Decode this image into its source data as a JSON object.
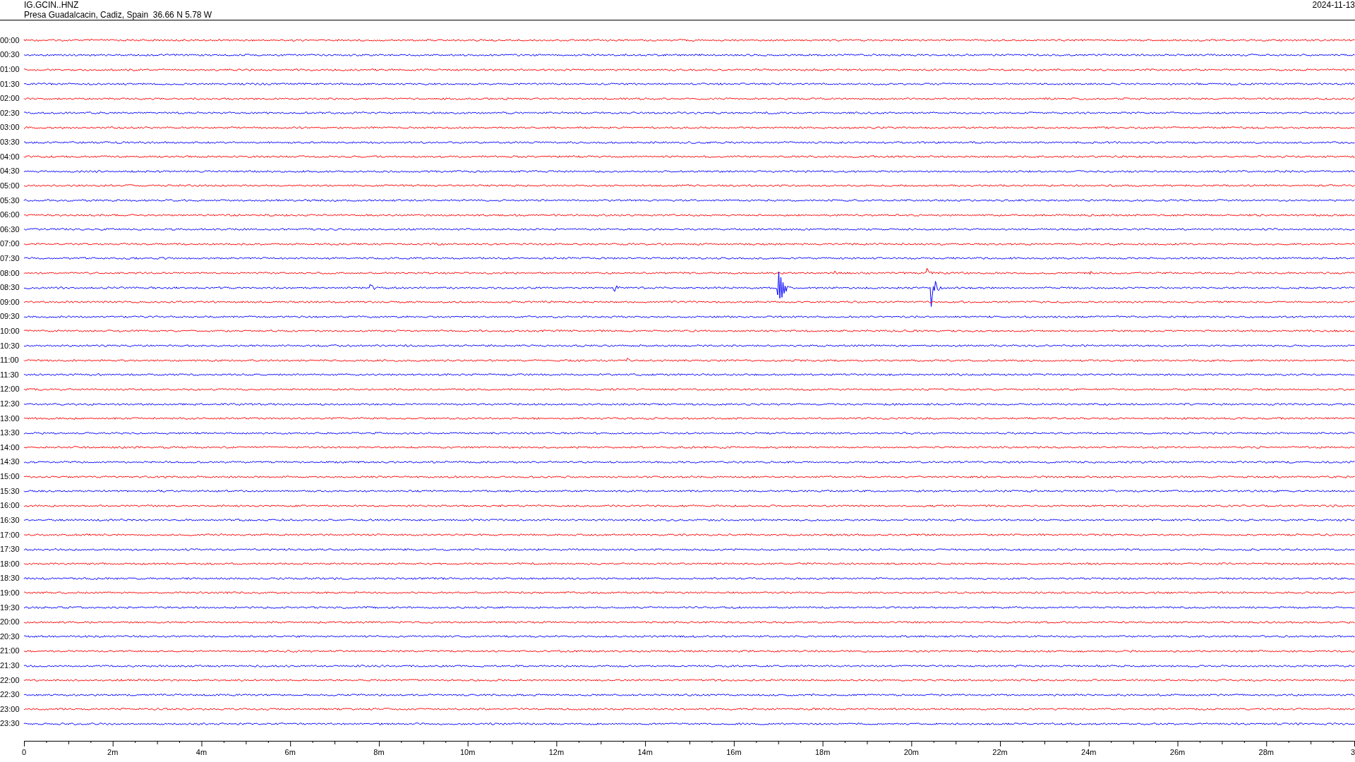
{
  "station": {
    "code": "IG.GCIN..HNZ",
    "location": "Presa Guadalcacin, Cadiz, Spain  36.66 N 5.78 W",
    "date": "2024-11-13"
  },
  "rows": [
    {
      "time": "00:00",
      "color": "#ff0000"
    },
    {
      "time": "00:30",
      "color": "#0000ff"
    },
    {
      "time": "01:00",
      "color": "#ff0000"
    },
    {
      "time": "01:30",
      "color": "#0000ff"
    },
    {
      "time": "02:00",
      "color": "#ff0000"
    },
    {
      "time": "02:30",
      "color": "#0000ff"
    },
    {
      "time": "03:00",
      "color": "#ff0000"
    },
    {
      "time": "03:30",
      "color": "#0000ff"
    },
    {
      "time": "04:00",
      "color": "#ff0000"
    },
    {
      "time": "04:30",
      "color": "#0000ff"
    },
    {
      "time": "05:00",
      "color": "#ff0000"
    },
    {
      "time": "05:30",
      "color": "#0000ff"
    },
    {
      "time": "06:00",
      "color": "#ff0000"
    },
    {
      "time": "06:30",
      "color": "#0000ff"
    },
    {
      "time": "07:00",
      "color": "#ff0000"
    },
    {
      "time": "07:30",
      "color": "#0000ff"
    },
    {
      "time": "08:00",
      "color": "#ff0000"
    },
    {
      "time": "08:30",
      "color": "#0000ff"
    },
    {
      "time": "09:00",
      "color": "#ff0000"
    },
    {
      "time": "09:30",
      "color": "#0000ff"
    },
    {
      "time": "10:00",
      "color": "#ff0000"
    },
    {
      "time": "10:30",
      "color": "#0000ff"
    },
    {
      "time": "11:00",
      "color": "#ff0000"
    },
    {
      "time": "11:30",
      "color": "#0000ff"
    },
    {
      "time": "12:00",
      "color": "#ff0000"
    },
    {
      "time": "12:30",
      "color": "#0000ff"
    },
    {
      "time": "13:00",
      "color": "#ff0000"
    },
    {
      "time": "13:30",
      "color": "#0000ff"
    },
    {
      "time": "14:00",
      "color": "#ff0000"
    },
    {
      "time": "14:30",
      "color": "#0000ff"
    },
    {
      "time": "15:00",
      "color": "#ff0000"
    },
    {
      "time": "15:30",
      "color": "#0000ff"
    },
    {
      "time": "16:00",
      "color": "#ff0000"
    },
    {
      "time": "16:30",
      "color": "#0000ff"
    },
    {
      "time": "17:00",
      "color": "#ff0000"
    },
    {
      "time": "17:30",
      "color": "#0000ff"
    },
    {
      "time": "18:00",
      "color": "#ff0000"
    },
    {
      "time": "18:30",
      "color": "#0000ff"
    },
    {
      "time": "19:00",
      "color": "#ff0000"
    },
    {
      "time": "19:30",
      "color": "#0000ff"
    },
    {
      "time": "20:00",
      "color": "#ff0000"
    },
    {
      "time": "20:30",
      "color": "#0000ff"
    },
    {
      "time": "21:00",
      "color": "#ff0000"
    },
    {
      "time": "21:30",
      "color": "#0000ff"
    },
    {
      "time": "22:00",
      "color": "#ff0000"
    },
    {
      "time": "22:30",
      "color": "#0000ff"
    },
    {
      "time": "23:00",
      "color": "#ff0000"
    },
    {
      "time": "23:30",
      "color": "#0000ff"
    }
  ],
  "time_axis": {
    "labels": [
      "0",
      "2m",
      "4m",
      "6m",
      "8m",
      "10m",
      "12m",
      "14m",
      "16m",
      "18m",
      "20m",
      "22m",
      "24m",
      "26m",
      "28m",
      "3"
    ]
  }
}
